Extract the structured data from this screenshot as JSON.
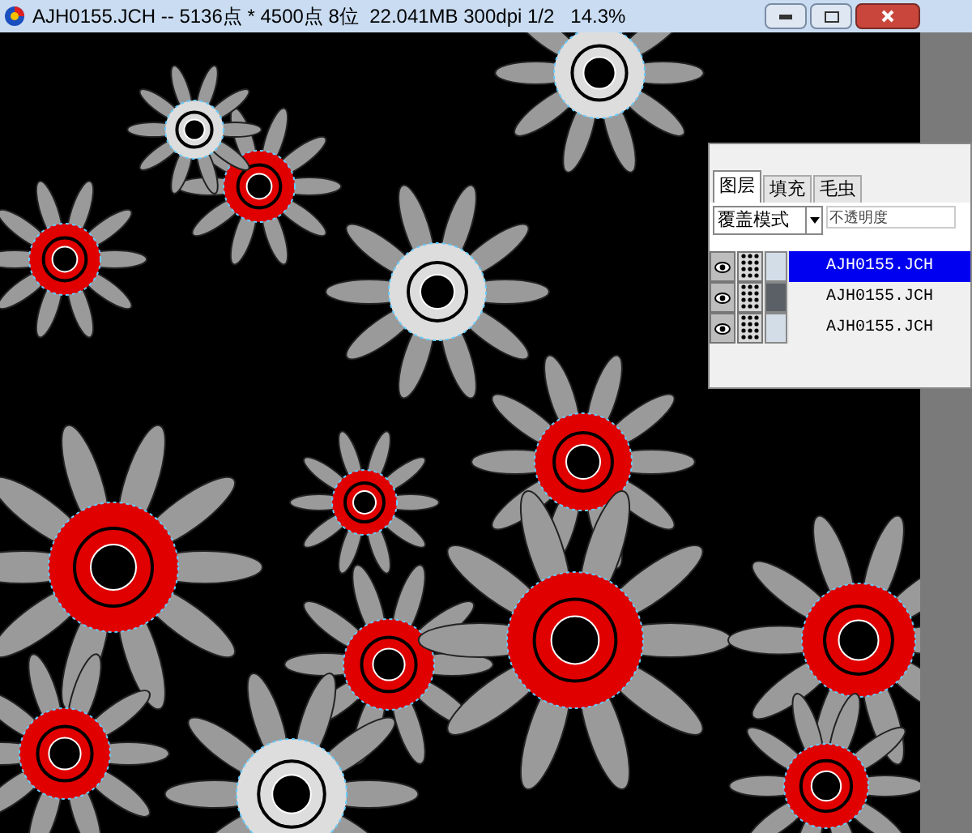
{
  "window": {
    "title": "AJH0155.JCH -- 5136点 * 4500点 8位  22.041MB 300dpi 1/2   14.3%"
  },
  "layer_panel": {
    "tabs": [
      {
        "label": "图层",
        "selected": true
      },
      {
        "label": "填充",
        "selected": false
      },
      {
        "label": "毛虫",
        "selected": false
      }
    ],
    "blend_mode": "覆盖模式",
    "opacity_placeholder": "不透明度",
    "layers": [
      {
        "name": "AJH0155.JCH",
        "selected": true,
        "color": "#d3dde8"
      },
      {
        "name": "AJH0155.JCH",
        "selected": false,
        "color": "#5b5f66"
      },
      {
        "name": "AJH0155.JCH",
        "selected": false,
        "color": "#d3dde8"
      }
    ]
  }
}
